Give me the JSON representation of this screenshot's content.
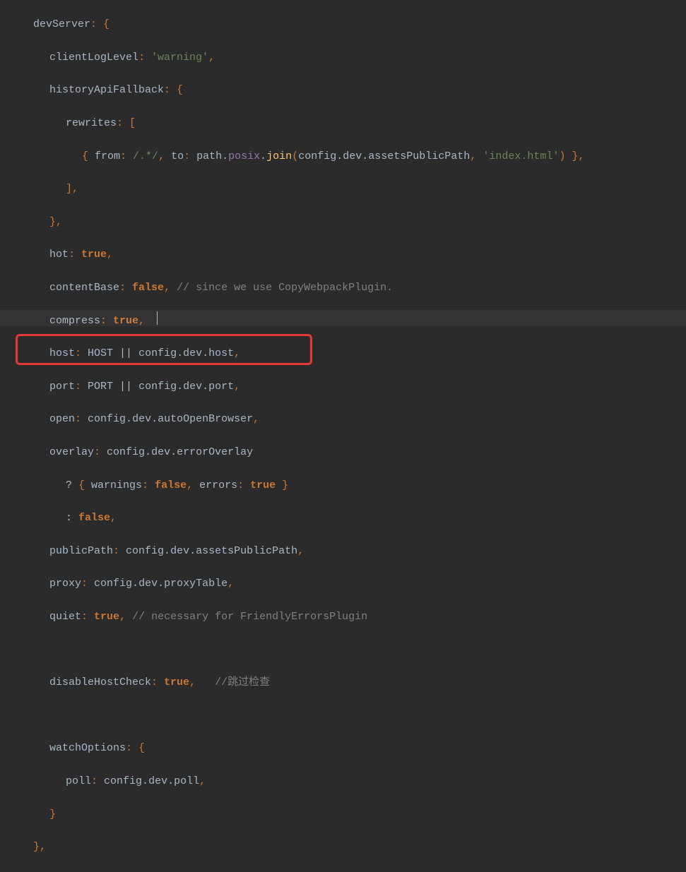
{
  "code": {
    "devServer_key": "devServer",
    "clientLogLevel_key": "clientLogLevel",
    "clientLogLevel_val": "'warning'",
    "historyApiFallback_key": "historyApiFallback",
    "rewrites_key": "rewrites",
    "from_key": "from",
    "from_regex": "/.*/",
    "to_key": "to",
    "path_obj": "path",
    "posix_prop": "posix",
    "join_method": "join",
    "config_obj": "config",
    "dev_prop": "dev",
    "assetsPublicPath_prop": "assetsPublicPath",
    "index_html": "'index.html'",
    "hot_key": "hot",
    "true_kw": "true",
    "false_kw": "false",
    "contentBase_key": "contentBase",
    "contentBase_comment": "// since we use CopyWebpackPlugin.",
    "compress_key": "compress",
    "host_key": "host",
    "HOST": "HOST",
    "host_prop": "host",
    "port_key": "port",
    "PORT": "PORT",
    "port_prop": "port",
    "open_key": "open",
    "autoOpenBrowser_prop": "autoOpenBrowser",
    "overlay_key": "overlay",
    "errorOverlay_prop": "errorOverlay",
    "warnings_key": "warnings",
    "errors_key": "errors",
    "publicPath_key": "publicPath",
    "proxy_key": "proxy",
    "proxyTable_prop": "proxyTable",
    "quiet_key": "quiet",
    "quiet_comment": "// necessary for FriendlyErrorsPlugin",
    "disableHostCheck_key": "disableHostCheck",
    "disableHostCheck_comment": "//跳过检查",
    "watchOptions_key": "watchOptions",
    "poll_key": "poll",
    "poll_prop": "poll"
  },
  "punct": {
    "colon_brace": ": {",
    "colon_bracket": ": [",
    "brace_open": "{ ",
    "colon_sp": ": ",
    "comma_sp": ", ",
    "paren_open": "(",
    "paren_close_brace_comma": ") },",
    "close_bracket_comma": "],",
    "close_brace_comma": "},",
    "comma": ",",
    "pipe_pipe": " || ",
    "dot": ".",
    "question": "? ",
    "colon_alt": ": ",
    "brace_close": " }",
    "open_brace": "{",
    "close_brace": "}",
    "slash": "/"
  }
}
